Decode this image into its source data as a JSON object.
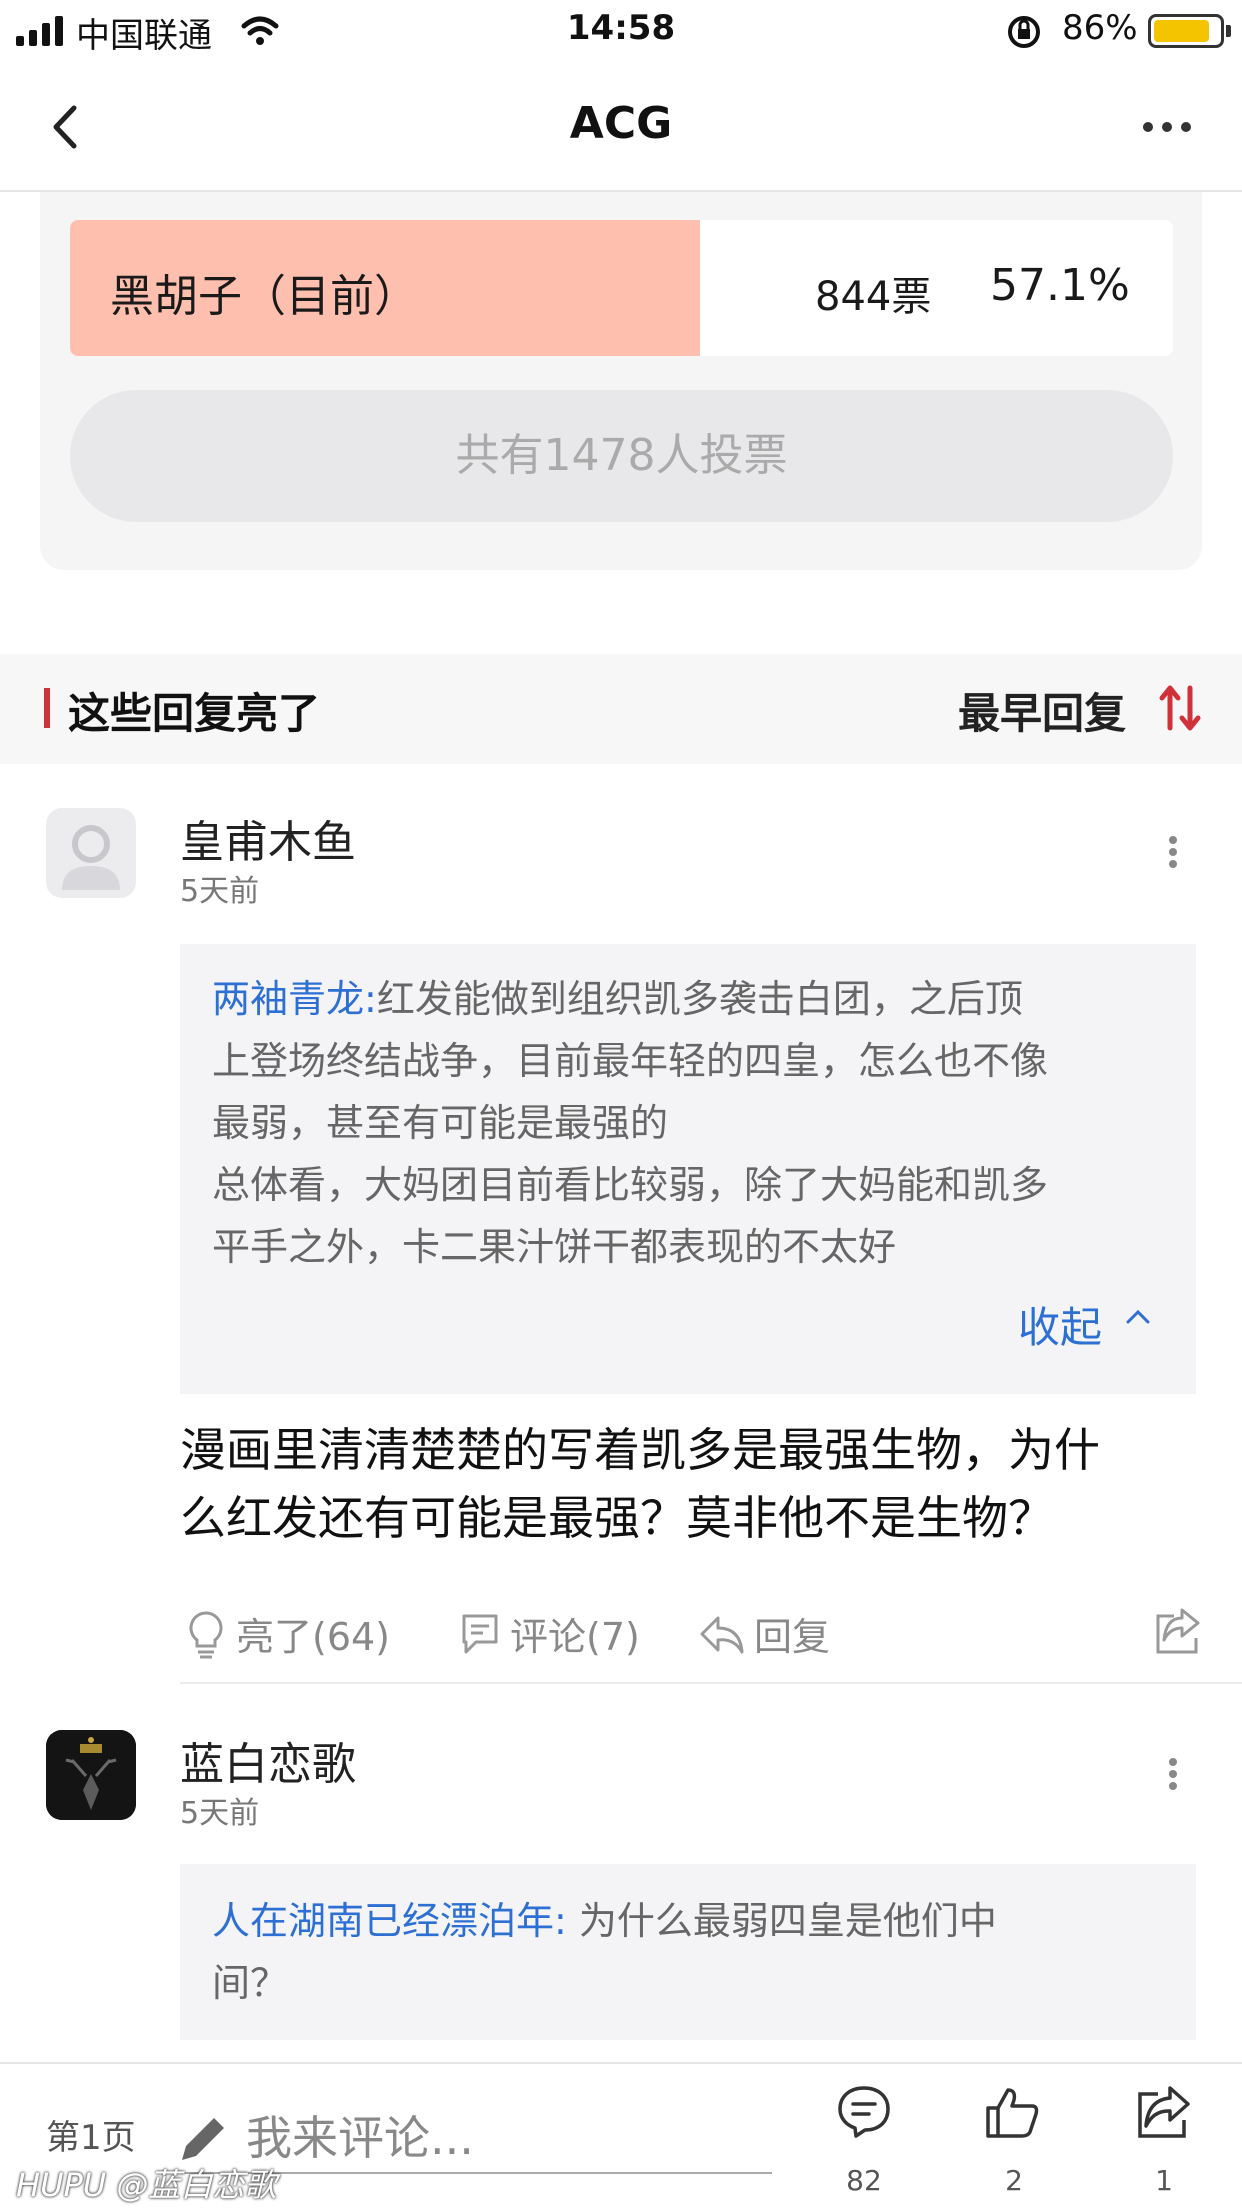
{
  "status_bar": {
    "carrier": "中国联通",
    "time": "14:58",
    "battery_pct": "86%",
    "battery_level": 0.86,
    "battery_color": "#f5c400"
  },
  "nav": {
    "title": "ACG",
    "back_icon": "chevron-left-icon",
    "more_icon": "more-horizontal-icon"
  },
  "poll": {
    "option_label": "黑胡子（目前）",
    "votes": "844票",
    "percent": "57.1%",
    "fill_fraction": 0.571,
    "fill_color": "#ffbfae",
    "total_text": "共有1478人投票"
  },
  "section": {
    "title": "这些回复亮了",
    "sort_label": "最早回复",
    "accent_color": "#d0323a"
  },
  "comments": [
    {
      "username": "皇甫木鱼",
      "time": "5天前",
      "quote_author": "两袖青龙:",
      "quote_lines": [
        "红发能做到组织凯多袭击白团，之后顶",
        "上登场终结战争，目前最年轻的四皇，怎么也不像",
        "最弱，甚至有可能是最强的",
        "总体看，大妈团目前看比较弱，除了大妈能和凯多",
        "平手之外，卡二果汁饼干都表现的不太好"
      ],
      "collapse_label": "收起",
      "body_lines": [
        "漫画里清清楚楚的写着凯多是最强生物，为什",
        "么红发还有可能是最强？莫非他不是生物？"
      ],
      "like_label": "亮了(64)",
      "comment_label": "评论(7)",
      "reply_label": "回复"
    },
    {
      "username": "蓝白恋歌",
      "time": "5天前",
      "quote_author": "人在湖南已经漂泊年:",
      "quote_lines": [
        " 为什么最弱四皇是他们中",
        "间？"
      ]
    }
  ],
  "bottom_bar": {
    "page_label": "第1页",
    "comment_placeholder": "我来评论...",
    "comments_count": "82",
    "likes_count": "2",
    "shares_count": "1"
  },
  "watermark": "HUPU @蓝白恋歌",
  "link_color": "#2d6fd2"
}
